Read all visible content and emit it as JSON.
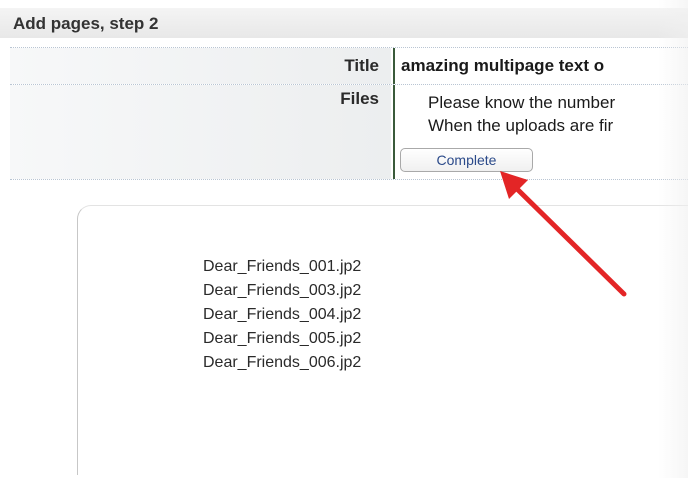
{
  "step_title": "Add pages, step 2",
  "form": {
    "title_label": "Title",
    "title_value": "amazing multipage text o",
    "files_label": "Files",
    "files_line1": "Please know the number",
    "files_line2": "When the uploads are fir",
    "complete_label": "Complete"
  },
  "files": [
    "Dear_Friends_001.jp2",
    "Dear_Friends_003.jp2",
    "Dear_Friends_004.jp2",
    "Dear_Friends_005.jp2",
    "Dear_Friends_006.jp2"
  ],
  "colors": {
    "arrow": "#e32526",
    "button_text": "#2b4a8a",
    "cell_divider": "#3a5a3a"
  }
}
